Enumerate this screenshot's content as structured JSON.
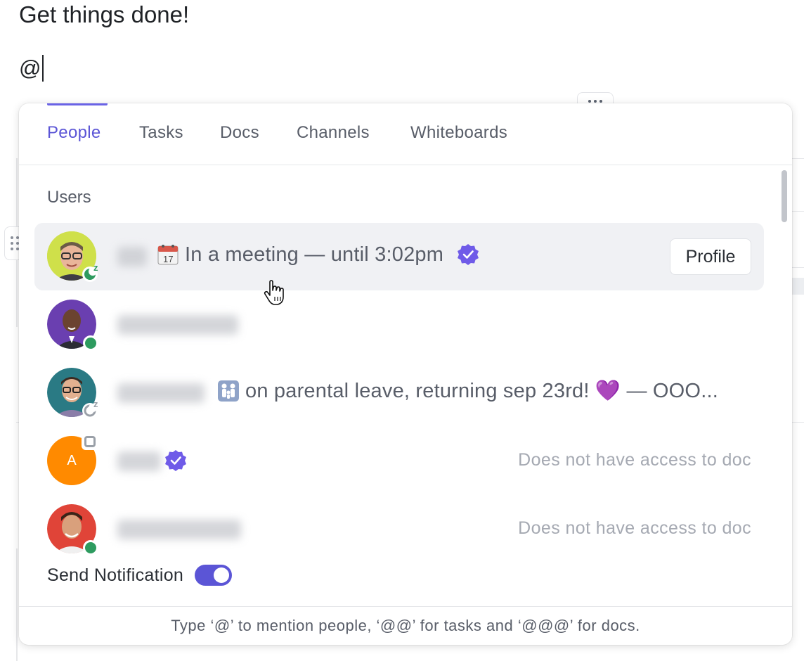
{
  "editor": {
    "doc_title": "Get things done!",
    "typed_text": "@"
  },
  "mention_popup": {
    "tabs": [
      {
        "label": "People",
        "active": true
      },
      {
        "label": "Tasks",
        "active": false
      },
      {
        "label": "Docs",
        "active": false
      },
      {
        "label": "Channels",
        "active": false
      },
      {
        "label": "Whiteboards",
        "active": false
      }
    ],
    "section_label": "Users",
    "users": [
      {
        "status_text": "In a meeting — until 3:02pm",
        "status_emoji": "calendar-icon",
        "verified": true,
        "presence": "away",
        "action_label": "Profile",
        "hovered": true
      },
      {
        "status_text": "",
        "verified": false,
        "presence": "online",
        "action_label": ""
      },
      {
        "status_text": "on parental leave, returning sep 23rd! 💜 — OOO...",
        "status_emoji": "family-icon",
        "verified": false,
        "presence": "away-offline"
      },
      {
        "avatar_initial": "A",
        "verified": true,
        "presence": "offline",
        "access_note": "Does not have access to doc"
      },
      {
        "verified": false,
        "presence": "online",
        "access_note": "Does not have access to doc"
      }
    ],
    "send_notification_label": "Send Notification",
    "send_notification_enabled": true,
    "footer_hint": "Type ‘@’ to mention people, ‘@@’ for tasks and ‘@@@’ for docs."
  },
  "colors": {
    "accent": "#5b55d6",
    "online": "#2e9b5f",
    "away": "#2e9b5f",
    "text_muted": "#a5a9b2"
  }
}
